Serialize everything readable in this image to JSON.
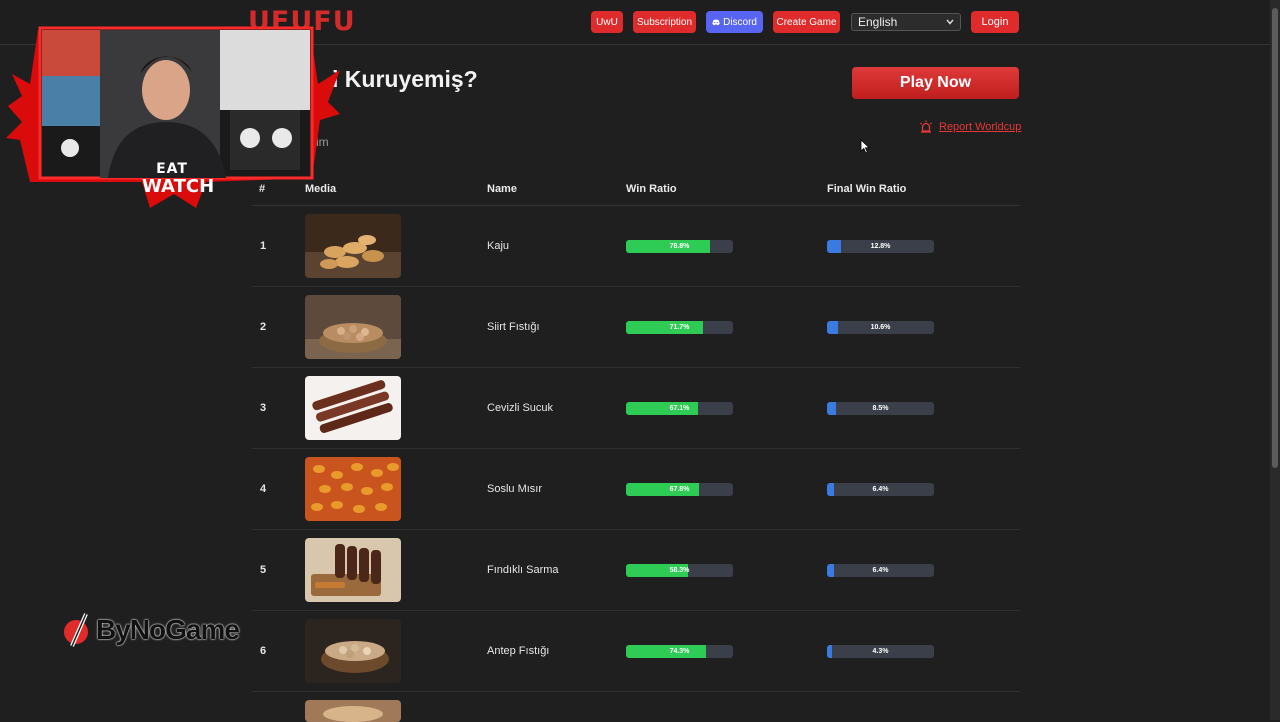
{
  "header": {
    "logo": "UFUFU",
    "nav": {
      "uwu": "UwU",
      "subscription": "Subscription",
      "discord": "Discord",
      "create_game": "Create Game",
      "language": "English",
      "login": "Login"
    }
  },
  "page": {
    "title": "i Kuruyemiş?",
    "subtitle": "rim",
    "play_now": "Play Now",
    "report": "Report Worldcup"
  },
  "table": {
    "headers": {
      "num": "#",
      "media": "Media",
      "name": "Name",
      "win": "Win Ratio",
      "final": "Final Win Ratio"
    },
    "rows": [
      {
        "num": "1",
        "name": "Kaju",
        "win_label": "78.8%",
        "win": 78.8,
        "final_label": "12.8%",
        "final": 12.8
      },
      {
        "num": "2",
        "name": "Siirt Fıstığı",
        "win_label": "71.7%",
        "win": 71.7,
        "final_label": "10.6%",
        "final": 10.6
      },
      {
        "num": "3",
        "name": "Cevizli Sucuk",
        "win_label": "67.1%",
        "win": 67.1,
        "final_label": "8.5%",
        "final": 8.5
      },
      {
        "num": "4",
        "name": "Soslu Mısır",
        "win_label": "67.8%",
        "win": 67.8,
        "final_label": "6.4%",
        "final": 6.4
      },
      {
        "num": "5",
        "name": "Fındıklı Sarma",
        "win_label": "58.3%",
        "win": 58.3,
        "final_label": "6.4%",
        "final": 6.4
      },
      {
        "num": "6",
        "name": "Antep Fıstığı",
        "win_label": "74.3%",
        "win": 74.3,
        "final_label": "4.3%",
        "final": 4.3
      }
    ]
  },
  "overlay": {
    "watermark": "ByNoGame",
    "badge_top": "EAT",
    "badge_bottom": "WATCH"
  },
  "colors": {
    "accent_red": "#df2b2b",
    "discord": "#5865f2",
    "win_green": "#2ecc55",
    "final_blue": "#3b7ae0"
  }
}
